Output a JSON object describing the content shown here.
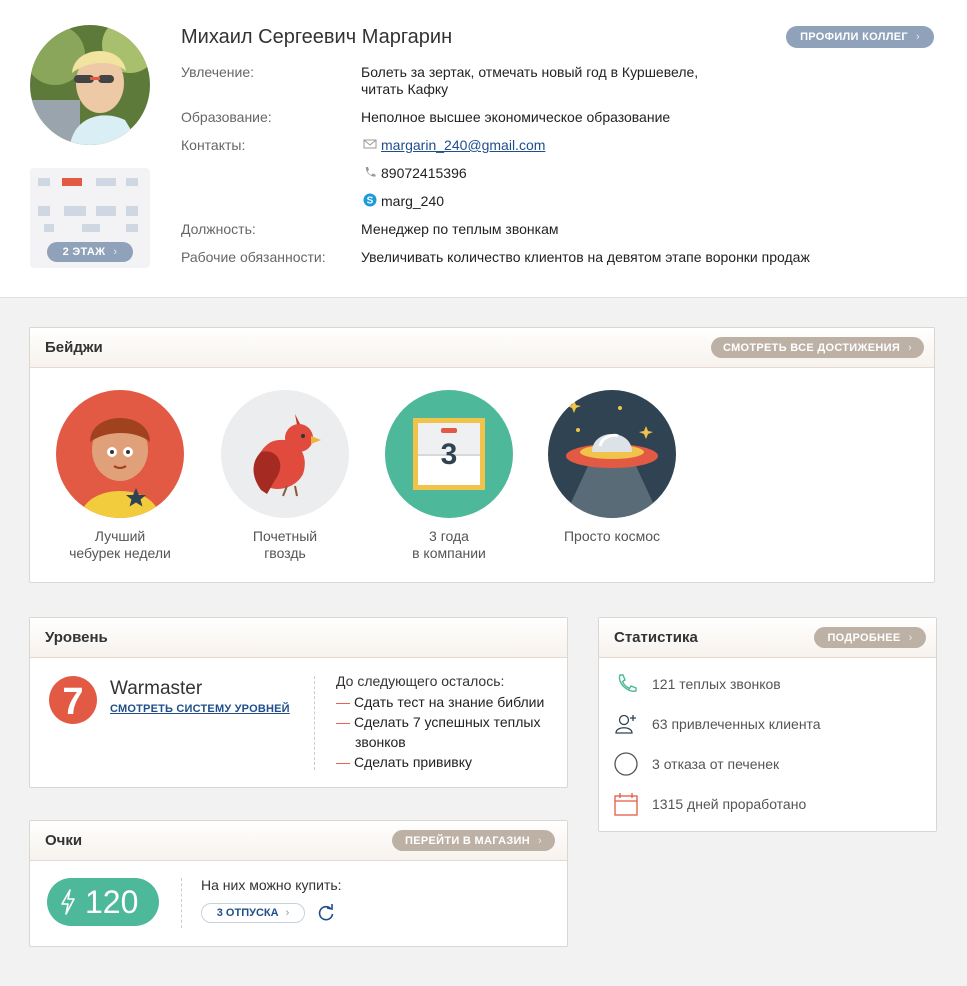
{
  "profile": {
    "name": "Михаил Сергеевич Маргарин",
    "colleagues_button": "ПРОФИЛИ КОЛЛЕГ",
    "floor_button": "2 ЭТАЖ",
    "hobby_label": "Увлечение:",
    "hobby_value": "Болеть за зертак, отмечать новый год в Куршевеле,\nчитать Кафку",
    "education_label": "Образование:",
    "education_value": "Неполное высшее экономическое образование",
    "contacts_label": "Контакты:",
    "email": "margarin_240@gmail.com",
    "phone": "89072415396",
    "skype": "marg_240",
    "position_label": "Должность:",
    "position_value": "Менеджер по теплым звонкам",
    "duties_label": "Рабочие обязанности:",
    "duties_value": "Увеличивать количество клиентов на девятом этапе воронки продаж",
    "icons": {
      "email": "envelope-icon",
      "phone": "phone-icon",
      "skype": "skype-icon"
    }
  },
  "badges": {
    "title": "Бейджи",
    "button": "СМОТРЕТЬ ВСЕ ДОСТИЖЕНИЯ",
    "items": [
      {
        "label": "Лучший\nчебурек недели",
        "icon": "boy-star-icon",
        "color": "#e35a44"
      },
      {
        "label": "Почетный\nгвоздь",
        "icon": "cardinal-bird-icon",
        "color": "#ebedee"
      },
      {
        "label": "3 года\nв компании",
        "icon": "calendar-icon",
        "color": "#4db89a",
        "day": "3"
      },
      {
        "label": "Просто космос",
        "icon": "ufo-icon",
        "color": "#2f4353"
      }
    ]
  },
  "level": {
    "title": "Уровень",
    "number": "7",
    "name": "Warmaster",
    "link": "СМОТРЕТЬ СИСТЕМУ УРОВНЕЙ",
    "next_title": "До следующего осталось:",
    "tasks": [
      "Сдать тест на знание библии",
      "Сделать 7 успешных теплых",
      "звонков",
      "Сделать прививку"
    ]
  },
  "points": {
    "title": "Очки",
    "button": "ПЕРЕЙТИ В МАГАЗИН",
    "value": "120",
    "buy_title": "На них можно купить:",
    "buy_option": "3 ОТПУСКА"
  },
  "stats": {
    "title": "Статистика",
    "button": "ПОДРОБНЕЕ",
    "items": [
      {
        "count": "121",
        "text": "теплых звонков",
        "icon": "phone-icon"
      },
      {
        "count": "63",
        "text": "привлеченных клиента",
        "icon": "user-add-icon"
      },
      {
        "count": "3",
        "text": "отказа от печенек",
        "icon": "circle-icon"
      },
      {
        "count": "1315",
        "text": "дней проработано",
        "icon": "calendar-icon"
      }
    ]
  },
  "colors": {
    "accent_blue": "#8fa2ba",
    "header_button": "#bdb1a6",
    "green": "#4db89a",
    "red": "#e35a44",
    "link": "#1f4e8c"
  }
}
